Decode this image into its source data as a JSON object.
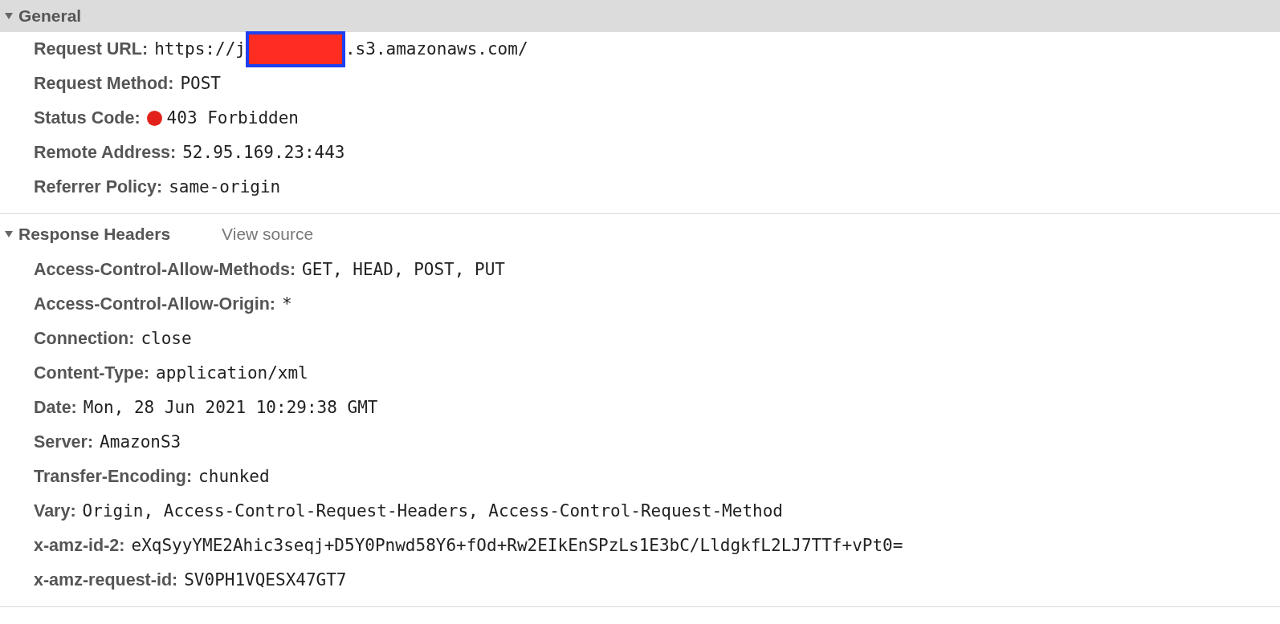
{
  "sections": [
    {
      "title": "General",
      "expanded": true,
      "shaded": true,
      "rows": [
        {
          "kind": "url",
          "name": "Request URL:",
          "value_prefix": "https://j",
          "value_suffix": ".s3.amazonaws.com/"
        },
        {
          "kind": "text",
          "name": "Request Method:",
          "value": "POST"
        },
        {
          "kind": "status",
          "name": "Status Code:",
          "value": "403 Forbidden",
          "color": "#e3211b"
        },
        {
          "kind": "text",
          "name": "Remote Address:",
          "value": "52.95.169.23:443"
        },
        {
          "kind": "text",
          "name": "Referrer Policy:",
          "value": "same-origin"
        }
      ]
    },
    {
      "title": "Response Headers",
      "expanded": true,
      "shaded": false,
      "link": "View source",
      "rows": [
        {
          "kind": "text",
          "name": "Access-Control-Allow-Methods:",
          "value": "GET, HEAD, POST, PUT"
        },
        {
          "kind": "text",
          "name": "Access-Control-Allow-Origin:",
          "value": "*"
        },
        {
          "kind": "text",
          "name": "Connection:",
          "value": "close"
        },
        {
          "kind": "text",
          "name": "Content-Type:",
          "value": "application/xml"
        },
        {
          "kind": "text",
          "name": "Date:",
          "value": "Mon, 28 Jun 2021 10:29:38 GMT"
        },
        {
          "kind": "text",
          "name": "Server:",
          "value": "AmazonS3"
        },
        {
          "kind": "text",
          "name": "Transfer-Encoding:",
          "value": "chunked"
        },
        {
          "kind": "text",
          "name": "Vary:",
          "value": "Origin, Access-Control-Request-Headers, Access-Control-Request-Method"
        },
        {
          "kind": "text",
          "name": "x-amz-id-2:",
          "value": "eXqSyyYME2Ahic3seqj+D5Y0Pnwd58Y6+fOd+Rw2EIkEnSPzLs1E3bC/LldgkfL2LJ7TTf+vPt0="
        },
        {
          "kind": "text",
          "name": "x-amz-request-id:",
          "value": "SV0PH1VQESX47GT7"
        }
      ]
    }
  ]
}
